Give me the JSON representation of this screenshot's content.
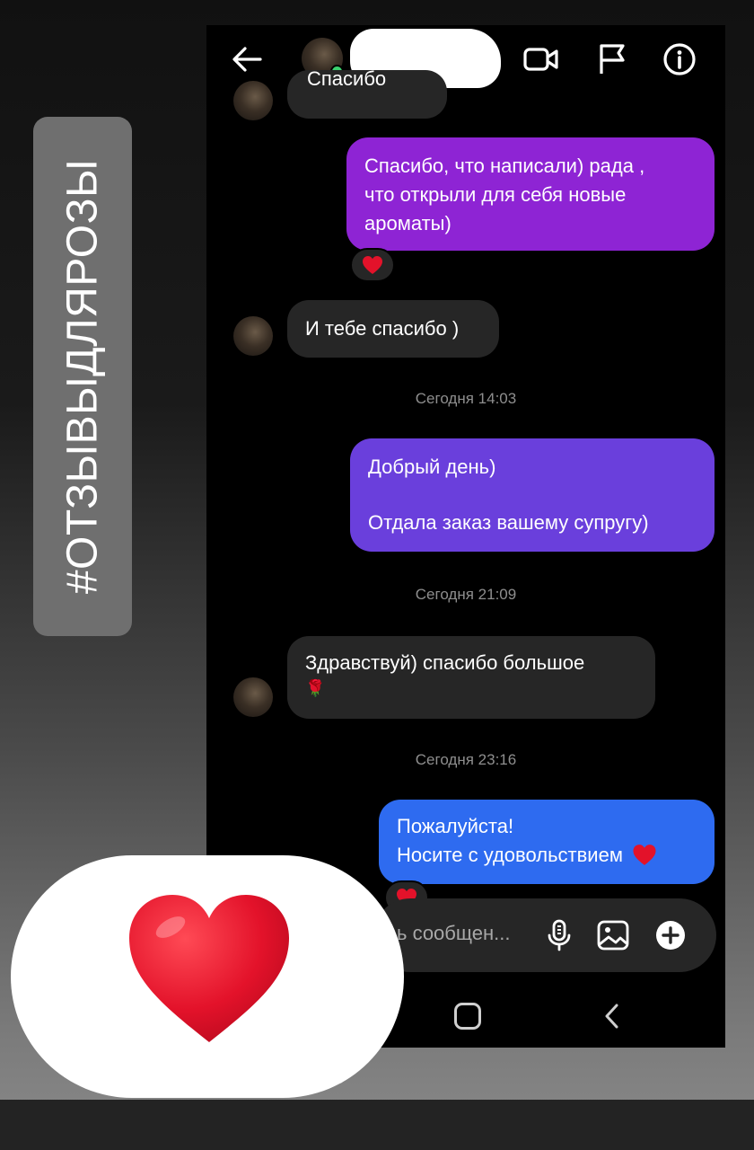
{
  "hashtag": "#ОТЗЫВЫДЛЯРОЗЫ",
  "header": {
    "back_icon": "arrow-left-icon",
    "icons": [
      "video-camera-icon",
      "flag-icon",
      "info-icon"
    ]
  },
  "messages": {
    "partial_incoming": "Спасибо",
    "m1": {
      "line1": "Спасибо,  что написали) рада ,",
      "line2": "что открыли для себя новые",
      "line3": "ароматы)"
    },
    "m2": "И тебе спасибо )",
    "stamp1": "Сегодня 14:03",
    "m3": {
      "line1": "Добрый день)",
      "line2": "Отдала заказ вашему супругу)"
    },
    "stamp2": "Сегодня 21:09",
    "m4": {
      "line1": "Здравствуй) спасибо большое",
      "line2": "🌹"
    },
    "stamp3": "Сегодня 23:16",
    "m5": {
      "line1": "Пожалуйста!",
      "line2": "Носите с удовольствием"
    }
  },
  "reaction_emoji": "❤️",
  "input": {
    "placeholder": "ь сообщен...",
    "icons": [
      "microphone-icon",
      "gallery-icon",
      "plus-icon"
    ]
  },
  "colors": {
    "bubble_purple": "#8e24d4",
    "bubble_violet": "#6a3fdc",
    "bubble_blue": "#2e6bf0",
    "bubble_incoming": "#262626",
    "heart_red": "#e3122a"
  }
}
